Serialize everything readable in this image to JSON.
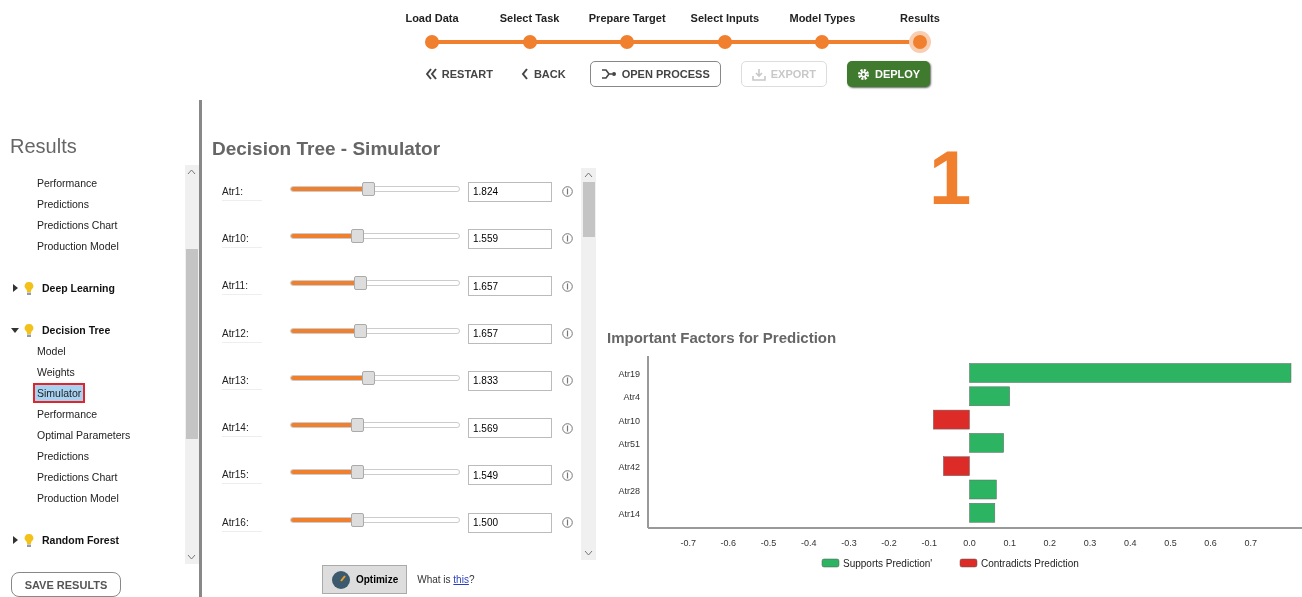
{
  "stepper": {
    "steps": [
      {
        "label": "Load Data",
        "selected": false
      },
      {
        "label": "Select Task",
        "selected": false
      },
      {
        "label": "Prepare Target",
        "selected": false
      },
      {
        "label": "Select Inputs",
        "selected": false
      },
      {
        "label": "Model Types",
        "selected": false
      },
      {
        "label": "Results",
        "selected": true
      }
    ]
  },
  "toolbar": [
    {
      "kind": "restart",
      "label": "RESTART",
      "disabled": false
    },
    {
      "kind": "back",
      "label": "BACK",
      "disabled": false
    },
    {
      "kind": "process",
      "label": "OPEN PROCESS",
      "disabled": false
    },
    {
      "kind": "export",
      "label": "EXPORT",
      "disabled": true
    },
    {
      "kind": "deploy",
      "label": "DEPLOY",
      "disabled": false
    }
  ],
  "sidebar": {
    "title": "Results",
    "top_items": [
      {
        "label": "Performance",
        "selected": false
      },
      {
        "label": "Predictions",
        "selected": false
      },
      {
        "label": "Predictions Chart",
        "selected": false
      },
      {
        "label": "Production Model",
        "selected": false
      }
    ],
    "groups": [
      {
        "label": "Deep Learning",
        "expanded": false
      },
      {
        "label": "Decision Tree",
        "expanded": true,
        "children": [
          {
            "label": "Model",
            "selected": false
          },
          {
            "label": "Weights",
            "selected": false
          },
          {
            "label": "Simulator",
            "selected": true
          },
          {
            "label": "Performance",
            "selected": false
          },
          {
            "label": "Optimal Parameters",
            "selected": false
          },
          {
            "label": "Predictions",
            "selected": false
          },
          {
            "label": "Predictions Chart",
            "selected": false
          },
          {
            "label": "Production Model",
            "selected": false
          }
        ]
      },
      {
        "label": "Random Forest",
        "expanded": false
      }
    ],
    "save_button": "SAVE RESULTS"
  },
  "simulator": {
    "title": "Decision Tree - Simulator",
    "inputs": [
      {
        "name": "Atr1:",
        "level": 0.46,
        "value": "1.824"
      },
      {
        "name": "Atr10:",
        "level": 0.39,
        "value": "1.559"
      },
      {
        "name": "Atr11:",
        "level": 0.41,
        "value": "1.657"
      },
      {
        "name": "Atr12:",
        "level": 0.41,
        "value": "1.657"
      },
      {
        "name": "Atr13:",
        "level": 0.46,
        "value": "1.833"
      },
      {
        "name": "Atr14:",
        "level": 0.39,
        "value": "1.569"
      },
      {
        "name": "Atr15:",
        "level": 0.39,
        "value": "1.549"
      },
      {
        "name": "Atr16:",
        "level": 0.39,
        "value": "1.500"
      }
    ],
    "optimize_button": "Optimize",
    "help_text": "What is ",
    "help_link": "this",
    "help_end": "?"
  },
  "annotation": "1",
  "factors": {
    "title": "Important Factors for Prediction",
    "chart_data": {
      "type": "bar",
      "orientation": "horizontal",
      "stacked": true,
      "categories": [
        "Atr19",
        "Atr4",
        "Atr10",
        "Atr51",
        "Atr42",
        "Atr28",
        "Atr14"
      ],
      "series": [
        {
          "name": "Supports Prediction'",
          "color": "#2db463",
          "values": [
            0.8,
            0.1,
            null,
            0.085,
            null,
            0.067,
            0.063
          ]
        },
        {
          "name": "Contradicts Prediction",
          "color": "#dd2c27",
          "values": [
            null,
            null,
            -0.09,
            null,
            -0.065,
            null,
            null
          ]
        }
      ],
      "xlim": [
        -0.8,
        0.8
      ],
      "xticks": [
        -0.7,
        -0.6,
        -0.5,
        -0.4,
        -0.3,
        -0.2,
        -0.1,
        {
          "value": 0,
          "label": "0.0"
        },
        0.1,
        0.2,
        0.3,
        0.4,
        0.5,
        0.6,
        0.7
      ],
      "legend": "bottom"
    }
  }
}
